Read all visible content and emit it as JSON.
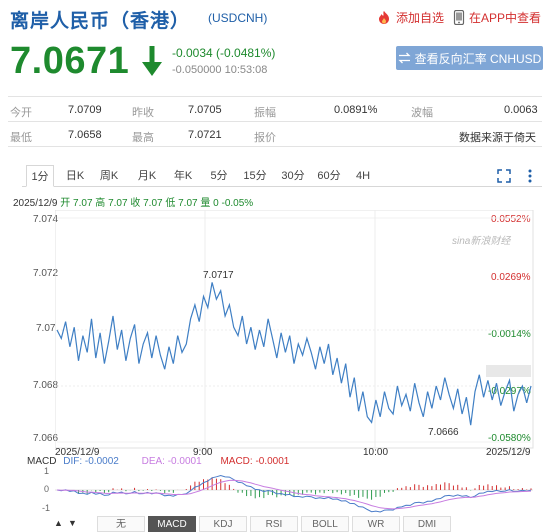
{
  "header": {
    "title": "离岸人民币（香港）",
    "code": "(USDCNH)",
    "add_watch": "添加自选",
    "app_view": "在APP中查看"
  },
  "quote": {
    "price": "7.0671",
    "change": "-0.0034 (-0.0481%)",
    "time": "-0.050000 10:53:08",
    "inverse_button": "查看反向汇率 CNHUSD",
    "down_color": "#1e8a2e"
  },
  "stats": [
    [
      {
        "label": "今开",
        "value": "7.0709"
      },
      {
        "label": "昨收",
        "value": "7.0705"
      },
      {
        "label": "振幅",
        "value": "0.0891%"
      },
      {
        "label": "波幅",
        "value": "0.0063"
      }
    ],
    [
      {
        "label": "最低",
        "value": "7.0658"
      },
      {
        "label": "最高",
        "value": "7.0721"
      },
      {
        "label": "报价",
        "value": ""
      },
      {
        "label": "",
        "value": "数据来源于倚天"
      }
    ]
  ],
  "tabs": [
    "1分",
    "日K",
    "周K",
    "月K",
    "年K",
    "5分",
    "15分",
    "30分",
    "60分",
    "4H"
  ],
  "active_tab": "1分",
  "infoline": {
    "date": "2025/12/9",
    "text": "开 7.07 高 7.07 收 7.07 低 7.07 量 0",
    "pct": "-0.05%"
  },
  "chart_data": {
    "type": "line",
    "y_left_ticks": [
      "7.074",
      "7.072",
      "7.07",
      "7.068",
      "7.066"
    ],
    "y_right_ticks": [
      "0.0552%",
      "0.0269%",
      "-0.0014%",
      "-0.0297%",
      "-0.0580%"
    ],
    "x_ticks": [
      "2025/12/9",
      "9:00",
      "10:00",
      "2025/12/9"
    ],
    "annotations": [
      "7.0717",
      "7.0666"
    ],
    "watermark": "sina新浪财经",
    "ylim": [
      7.066,
      7.074
    ],
    "series": [
      {
        "values": [
          7.07,
          7.0697,
          7.0703,
          7.0694,
          7.0701,
          7.0689,
          7.0698,
          7.0692,
          7.0704,
          7.069,
          7.0699,
          7.0688,
          7.0696,
          7.0705,
          7.0693,
          7.07,
          7.0689,
          7.0697,
          7.0702,
          7.0688,
          7.0695,
          7.0699,
          7.069,
          7.0698,
          7.0691,
          7.0686,
          7.0694,
          7.0688,
          7.0698,
          7.0692,
          7.0695,
          7.0704,
          7.0709,
          7.0703,
          7.0712,
          7.0708,
          7.0717,
          7.0711,
          7.0714,
          7.0705,
          7.0709,
          7.0701,
          7.0698,
          7.0705,
          7.0695,
          7.0701,
          7.0693,
          7.07,
          7.0694,
          7.0704,
          7.0697,
          7.069,
          7.0699,
          7.0692,
          7.0698,
          7.0688,
          7.0695,
          7.0691,
          7.0697,
          7.0692,
          7.0686,
          7.0694,
          7.0688,
          7.0695,
          7.0684,
          7.069,
          7.0681,
          7.0688,
          7.0676,
          7.0683,
          7.0671,
          7.0678,
          7.0669,
          7.0667,
          7.0675,
          7.0669,
          7.0678,
          7.0672,
          7.067,
          7.068,
          7.0673,
          7.0677,
          7.0671,
          7.0681,
          7.0674,
          7.0669,
          7.0678,
          7.0672,
          7.068,
          7.0675,
          7.0683,
          7.0677,
          7.0672,
          7.0679,
          7.067,
          7.0676,
          7.0666,
          7.0678,
          7.0684,
          7.0676,
          7.0682,
          7.0675,
          7.0681,
          7.0673,
          7.0678,
          7.0682,
          7.0671,
          7.0677,
          7.068,
          7.0674,
          7.068
        ]
      }
    ]
  },
  "macd": {
    "label": "MACD",
    "dif": "DIF: -0.0002",
    "dea": "DEA: -0.0001",
    "macd": "MACD: -0.0001",
    "ticks": [
      "1",
      "0",
      "-1"
    ]
  },
  "bottom_tabs": [
    "无",
    "MACD",
    "KDJ",
    "RSI",
    "BOLL",
    "WR",
    "DMI"
  ],
  "bottom_active": "MACD"
}
